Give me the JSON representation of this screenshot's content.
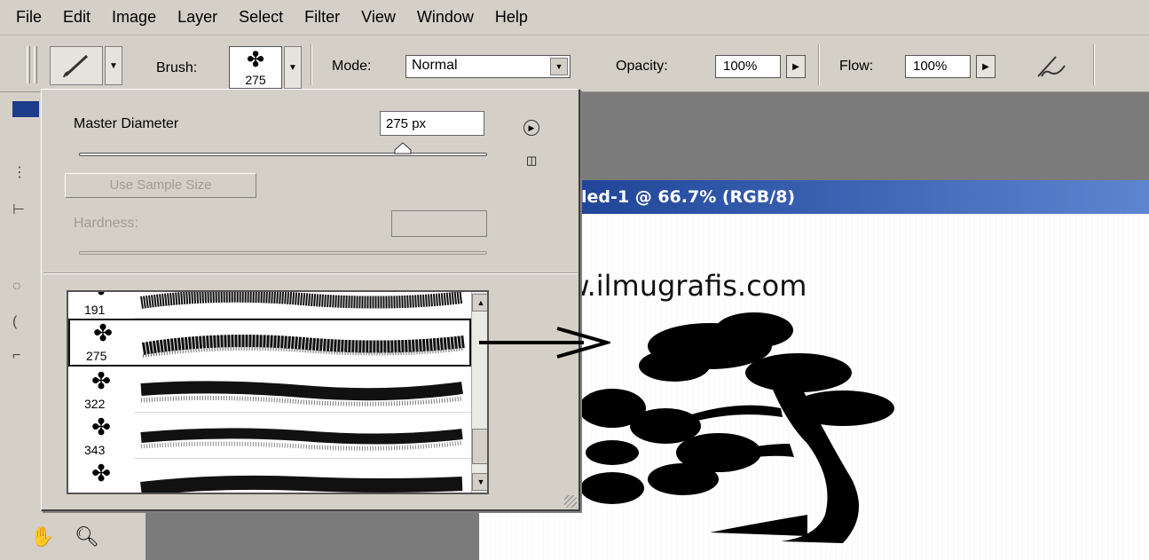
{
  "menu": [
    "File",
    "Edit",
    "Image",
    "Layer",
    "Select",
    "Filter",
    "View",
    "Window",
    "Help"
  ],
  "options": {
    "brush_label": "Brush:",
    "brush_size": "275",
    "mode_label": "Mode:",
    "mode_value": "Normal",
    "opacity_label": "Opacity:",
    "opacity_value": "100%",
    "flow_label": "Flow:",
    "flow_value": "100%"
  },
  "popup": {
    "master_diameter_label": "Master Diameter",
    "master_diameter_value": "275 px",
    "master_diameter_fraction": 0.78,
    "use_sample_size_label": "Use Sample Size",
    "hardness_label": "Hardness:",
    "brushes": [
      {
        "size": "191",
        "icon": "tree-brush-icon"
      },
      {
        "size": "275",
        "icon": "tree-brush-icon",
        "selected": true
      },
      {
        "size": "322",
        "icon": "tree-brush-icon"
      },
      {
        "size": "343",
        "icon": "tree-brush-icon"
      },
      {
        "size": "",
        "icon": "tree-brush-icon"
      }
    ]
  },
  "document": {
    "title": "led-1 @ 66.7% (RGB/8)",
    "watermark": "www.ilmugrafis.com"
  },
  "colors": {
    "titlebar": "#163a8f",
    "panel": "#d4d0c8",
    "workspace": "#7b7b7b"
  }
}
